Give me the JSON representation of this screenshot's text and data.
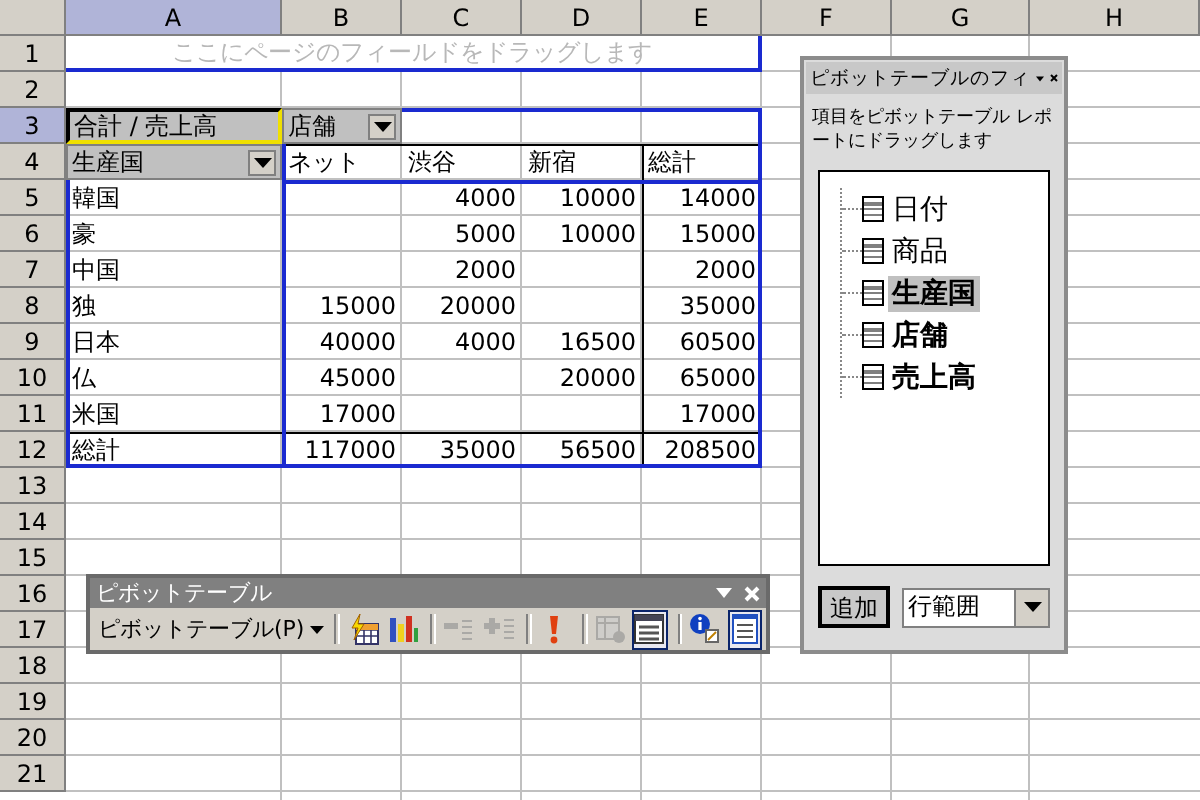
{
  "sheet": {
    "columns": [
      {
        "label": "A",
        "selected": true
      },
      {
        "label": "B",
        "selected": false
      },
      {
        "label": "C",
        "selected": false
      },
      {
        "label": "D",
        "selected": false
      },
      {
        "label": "E",
        "selected": false
      },
      {
        "label": "F",
        "selected": false
      },
      {
        "label": "G",
        "selected": false
      },
      {
        "label": "H",
        "selected": false
      }
    ],
    "rows": [
      {
        "label": "1",
        "selected": false
      },
      {
        "label": "2",
        "selected": false
      },
      {
        "label": "3",
        "selected": true
      },
      {
        "label": "4",
        "selected": false
      },
      {
        "label": "5",
        "selected": false
      },
      {
        "label": "6",
        "selected": false
      },
      {
        "label": "7",
        "selected": false
      },
      {
        "label": "8",
        "selected": false
      },
      {
        "label": "9",
        "selected": false
      },
      {
        "label": "10",
        "selected": false
      },
      {
        "label": "11",
        "selected": false
      },
      {
        "label": "12",
        "selected": false
      },
      {
        "label": "13",
        "selected": false
      },
      {
        "label": "14",
        "selected": false
      },
      {
        "label": "15",
        "selected": false
      },
      {
        "label": "16",
        "selected": false
      },
      {
        "label": "17",
        "selected": false
      },
      {
        "label": "18",
        "selected": false
      },
      {
        "label": "19",
        "selected": false
      },
      {
        "label": "20",
        "selected": false
      },
      {
        "label": "21",
        "selected": false
      }
    ]
  },
  "pivot": {
    "page_zone": "ここにページのフィールドをドラッグします",
    "data_field": "合計 / 売上高",
    "column_field": "店舗",
    "row_field": "生産国",
    "column_headers": [
      "ネット",
      "渋谷",
      "新宿",
      "総計"
    ],
    "rows": [
      {
        "label": "韓国",
        "shibuya": "4000",
        "shinjuku": "10000",
        "total": "14000"
      },
      {
        "label": "豪",
        "shibuya": "5000",
        "shinjuku": "10000",
        "total": "15000"
      },
      {
        "label": "中国",
        "shibuya": "2000",
        "total": "2000"
      },
      {
        "label": "独",
        "net": "15000",
        "shibuya": "20000",
        "total": "35000"
      },
      {
        "label": "日本",
        "net": "40000",
        "shibuya": "4000",
        "shinjuku": "16500",
        "total": "60500"
      },
      {
        "label": "仏",
        "net": "45000",
        "shinjuku": "20000",
        "total": "65000"
      },
      {
        "label": "米国",
        "net": "17000",
        "total": "17000"
      }
    ],
    "total": {
      "label": "総計",
      "net": "117000",
      "shibuya": "35000",
      "shinjuku": "56500",
      "total": "208500"
    }
  },
  "field_list": {
    "title": "ピボットテーブルのフィ",
    "instruction": "項目をピボットテーブル レポートにドラッグします",
    "fields": [
      {
        "label": "日付",
        "in_use": false,
        "selected": false
      },
      {
        "label": "商品",
        "in_use": false,
        "selected": false
      },
      {
        "label": "生産国",
        "in_use": true,
        "selected": true
      },
      {
        "label": "店舗",
        "in_use": true,
        "selected": false
      },
      {
        "label": "売上高",
        "in_use": true,
        "selected": false
      }
    ],
    "add_button": "追加",
    "area": "行範囲"
  },
  "toolbar": {
    "title": "ピボットテーブル",
    "menu": "ピボットテーブル(P)",
    "groups": [
      [
        {
          "kind": "format-report",
          "disabled": false,
          "pressed": false
        },
        {
          "kind": "chart",
          "disabled": false,
          "pressed": false
        }
      ],
      [
        {
          "kind": "hide-detail",
          "disabled": true,
          "pressed": false
        },
        {
          "kind": "show-detail",
          "disabled": true,
          "pressed": false
        }
      ],
      [
        {
          "kind": "refresh",
          "disabled": false,
          "pressed": false
        }
      ],
      [
        {
          "kind": "field-settings",
          "disabled": true,
          "pressed": false
        },
        {
          "kind": "show-items",
          "disabled": false,
          "pressed": true
        }
      ],
      [
        {
          "kind": "info",
          "disabled": false,
          "pressed": false
        },
        {
          "kind": "field-list",
          "disabled": false,
          "pressed": true
        }
      ]
    ]
  }
}
